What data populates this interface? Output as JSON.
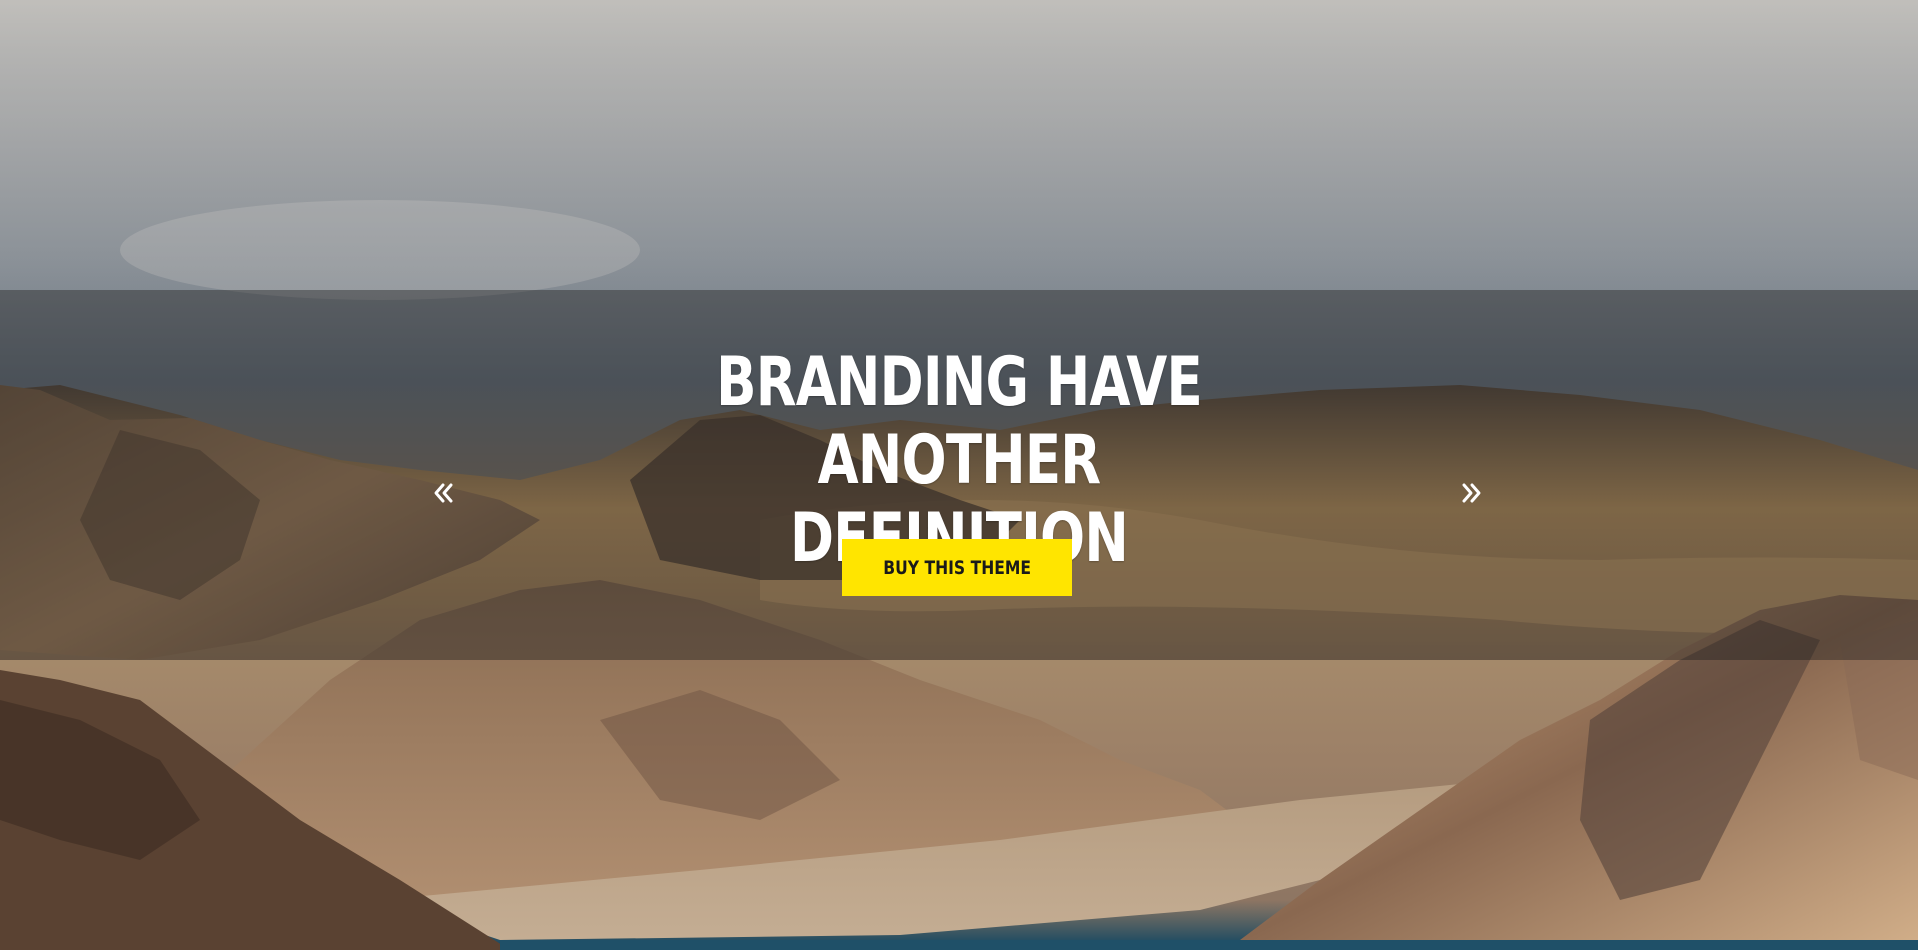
{
  "slider": {
    "headline_line1": "BRANDING HAVE ANOTHER",
    "headline_line2": "DEFINITION",
    "cta_label": "BUY THIS THEME",
    "prev_icon": "double-chevron-left-icon",
    "next_icon": "double-chevron-right-icon"
  },
  "colors": {
    "accent": "#ffe500",
    "text": "#ffffff",
    "band_overlay": "rgba(30,30,30,0.42)"
  }
}
